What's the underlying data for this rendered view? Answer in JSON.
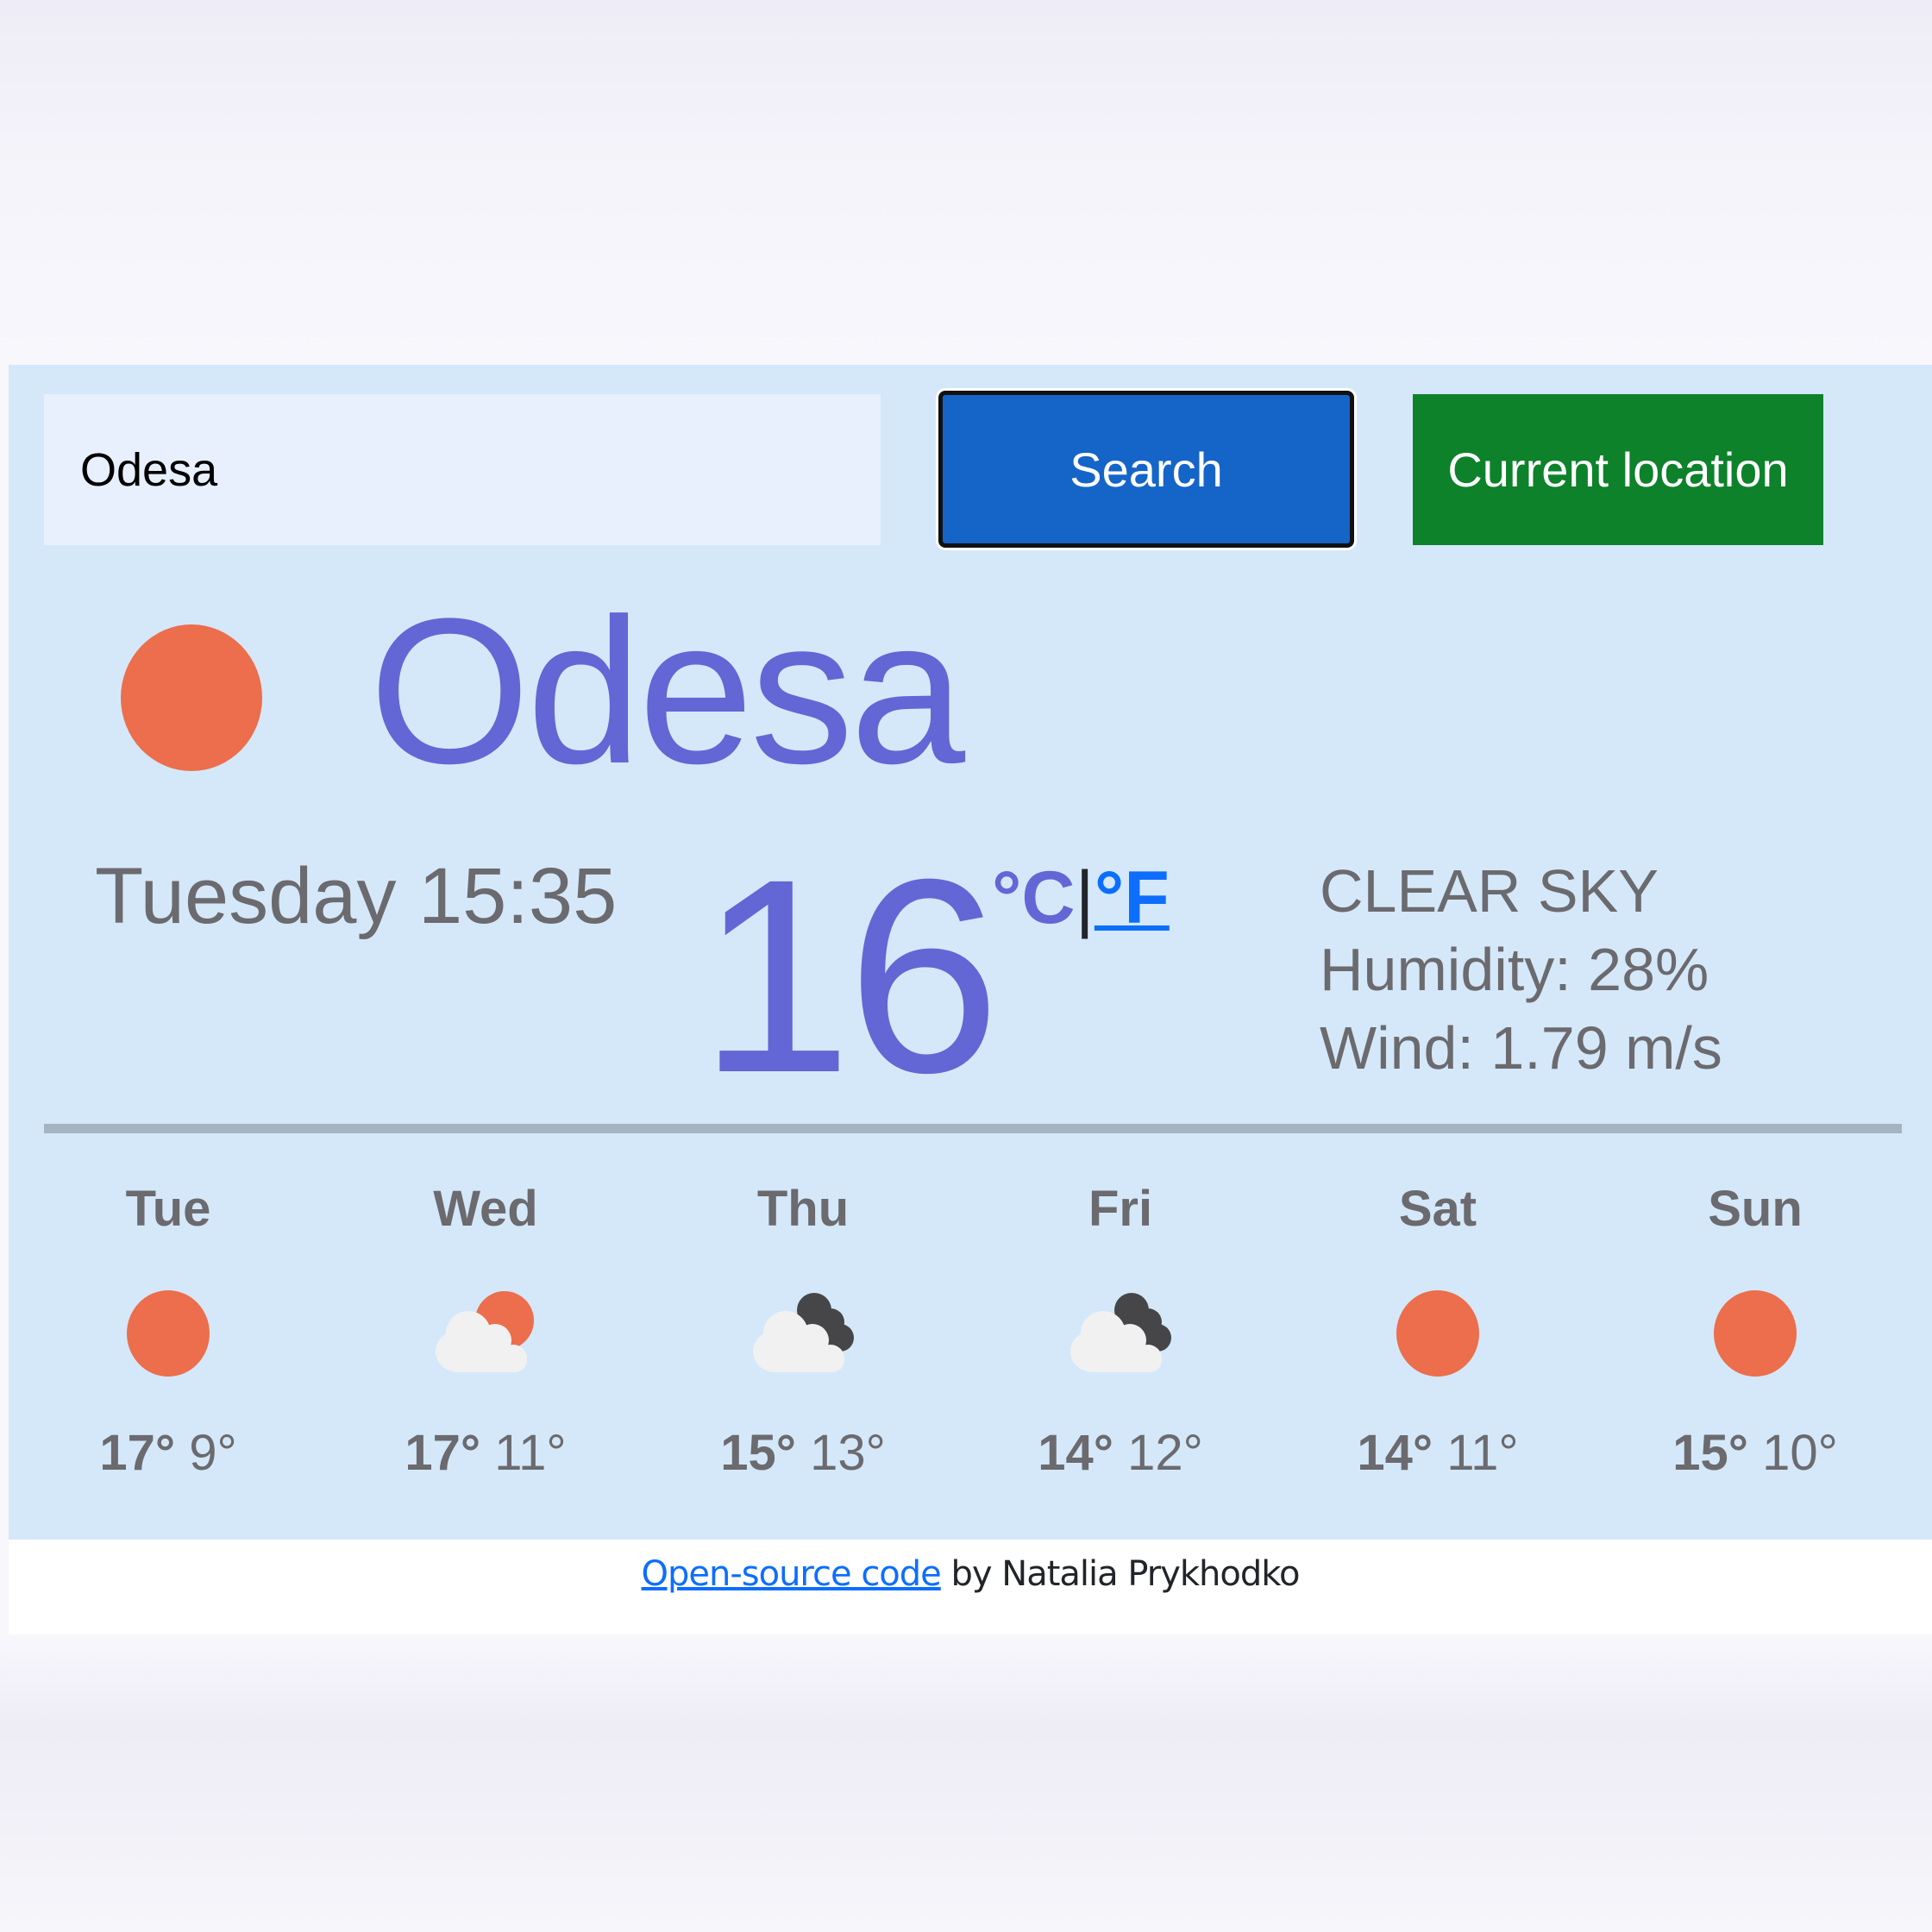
{
  "search": {
    "value": "Odesa",
    "button_label": "Search",
    "location_button_label": "Current location"
  },
  "current": {
    "city": "Odesa",
    "icon": "sun-icon",
    "datetime": "Tuesday 15:35",
    "temperature": "16",
    "unit_celsius": "°C",
    "unit_separator": "|",
    "unit_fahrenheit": "°F",
    "description": "CLEAR SKY",
    "humidity": "Humidity: 28%",
    "wind": "Wind: 1.79 m/s"
  },
  "forecast": [
    {
      "day": "Tue",
      "icon": "sun-icon",
      "max": "17°",
      "min": "9°"
    },
    {
      "day": "Wed",
      "icon": "cloud-sun-icon",
      "max": "17°",
      "min": "11°"
    },
    {
      "day": "Thu",
      "icon": "cloud-dark-cloud-icon",
      "max": "15°",
      "min": "13°"
    },
    {
      "day": "Fri",
      "icon": "cloud-dark-cloud-icon",
      "max": "14°",
      "min": "12°"
    },
    {
      "day": "Sat",
      "icon": "sun-icon",
      "max": "14°",
      "min": "11°"
    },
    {
      "day": "Sun",
      "icon": "sun-icon",
      "max": "15°",
      "min": "10°"
    }
  ],
  "footer": {
    "link_text": "Open-source code",
    "suffix": " by Natalia Prykhodko"
  },
  "colors": {
    "accent": "#6366d5",
    "search_button": "#1565c8",
    "location_button": "#0e812b",
    "sun": "#ec6e4c",
    "cloud_light": "#f1f1f1",
    "cloud_dark": "#464648",
    "panel": "#d4e8f9",
    "link": "#0d6efd"
  }
}
